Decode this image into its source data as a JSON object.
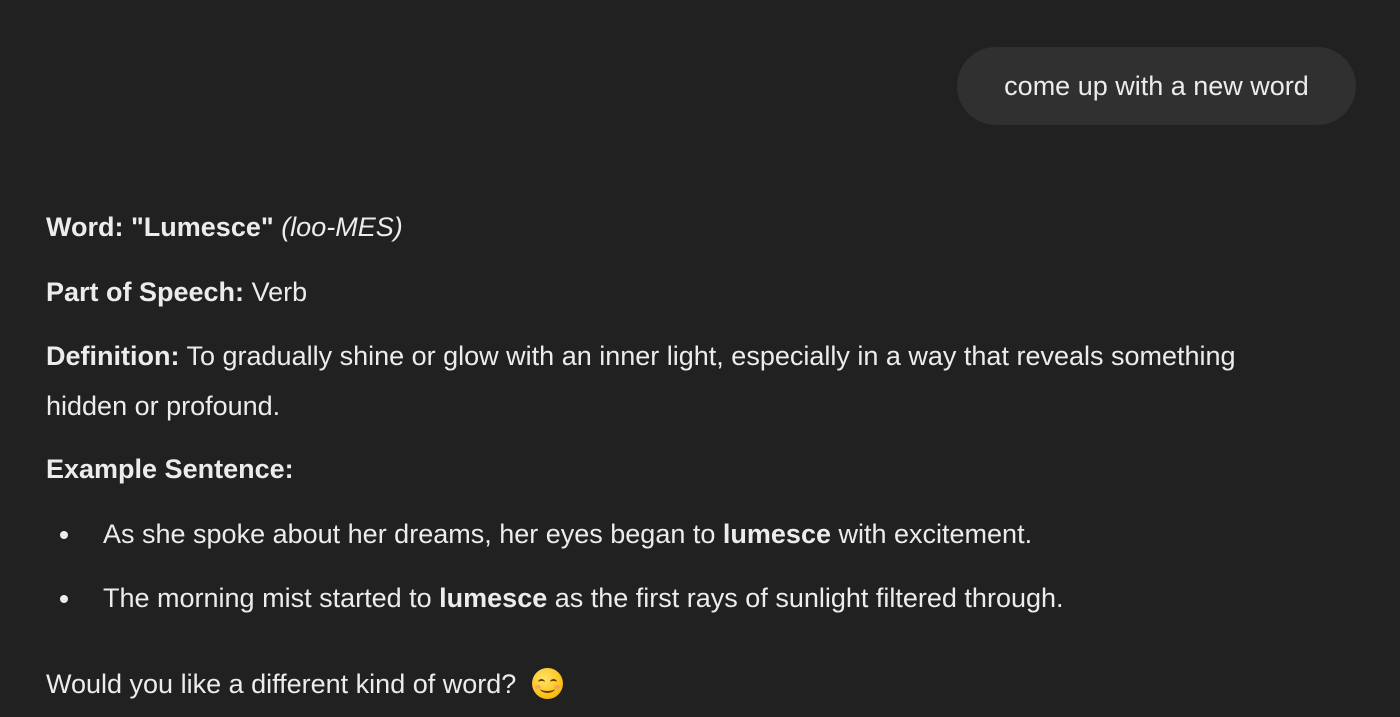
{
  "user_message": "come up with a new word",
  "assistant": {
    "word_label": "Word:",
    "word": "\"Lumesce\"",
    "pronunciation": "(loo-MES)",
    "pos_label": "Part of Speech:",
    "pos_value": "Verb",
    "definition_label": "Definition:",
    "definition_line1": "To gradually shine or glow with an inner light, especially in a way that reveals something",
    "definition_line2": "hidden or profound.",
    "example_label": "Example Sentence:",
    "examples": [
      {
        "before": "As she spoke about her dreams, her eyes began to",
        "bold": "lumesce",
        "after": "with excitement."
      },
      {
        "before": "The morning mist started to",
        "bold": "lumesce",
        "after": "as the first rays of sunlight filtered through."
      }
    ],
    "closing": "Would you like a different kind of word?",
    "closing_emoji": "smiling-face-icon"
  }
}
